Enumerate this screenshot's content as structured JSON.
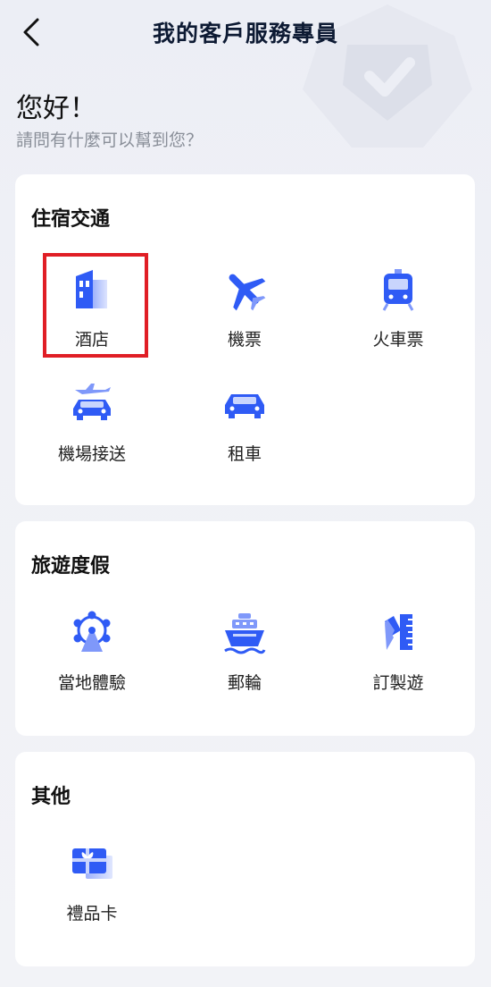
{
  "header": {
    "title": "我的客戶服務專員",
    "back_icon": "chevron-left-icon"
  },
  "greeting": {
    "title": "您好！",
    "subtitle": "請問有什麼可以幫到您？"
  },
  "sections": [
    {
      "title": "住宿交通",
      "items": [
        {
          "label": "酒店",
          "icon": "hotel-building-icon"
        },
        {
          "label": "機票",
          "icon": "airplane-icon"
        },
        {
          "label": "火車票",
          "icon": "train-icon"
        },
        {
          "label": "機場接送",
          "icon": "airport-transfer-icon"
        },
        {
          "label": "租車",
          "icon": "car-icon"
        }
      ]
    },
    {
      "title": "旅遊度假",
      "items": [
        {
          "label": "當地體驗",
          "icon": "ferris-wheel-icon"
        },
        {
          "label": "郵輪",
          "icon": "cruise-ship-icon"
        },
        {
          "label": "訂製遊",
          "icon": "custom-trip-ruler-pencil-icon"
        }
      ]
    },
    {
      "title": "其他",
      "items": [
        {
          "label": "禮品卡",
          "icon": "gift-card-icon"
        }
      ]
    }
  ],
  "colors": {
    "accent": "#2f5bf5",
    "highlight": "#e01e25",
    "title": "#0d1a33"
  }
}
